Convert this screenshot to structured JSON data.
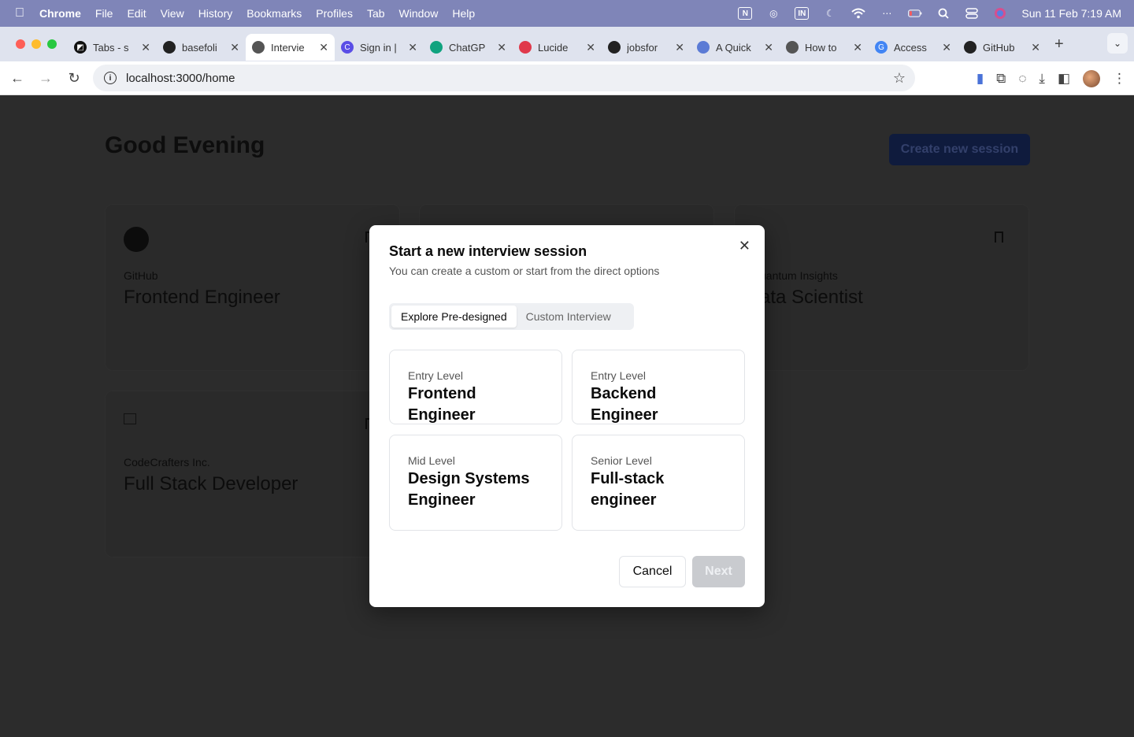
{
  "menubar": {
    "app": "Chrome",
    "items": [
      "File",
      "Edit",
      "View",
      "History",
      "Bookmarks",
      "Profiles",
      "Tab",
      "Window",
      "Help"
    ],
    "status_in": "IN",
    "datetime": "Sun 11 Feb  7:19 AM"
  },
  "tabs": [
    {
      "title": "Tabs - s",
      "icon": "notion-icon",
      "color": "#111111",
      "glyph": "◩"
    },
    {
      "title": "basefoli",
      "icon": "github-icon",
      "color": "#222222",
      "glyph": ""
    },
    {
      "title": "Intervie",
      "icon": "globe-icon",
      "color": "#555555",
      "glyph": "",
      "active": true
    },
    {
      "title": "Sign in |",
      "icon": "clerk-icon",
      "color": "#5a4ee6",
      "glyph": "C"
    },
    {
      "title": "ChatGP",
      "icon": "openai-icon",
      "color": "#10a37f",
      "glyph": ""
    },
    {
      "title": "Lucide",
      "icon": "lucide-icon",
      "color": "#e0394b",
      "glyph": ""
    },
    {
      "title": "jobsfor",
      "icon": "github-icon",
      "color": "#222222",
      "glyph": ""
    },
    {
      "title": "A Quick",
      "icon": "radar-icon",
      "color": "#5b7bd5",
      "glyph": ""
    },
    {
      "title": "How to",
      "icon": "wp-icon",
      "color": "#555555",
      "glyph": ""
    },
    {
      "title": "Access",
      "icon": "google-icon",
      "color": "#4285f4",
      "glyph": "G"
    },
    {
      "title": "GitHub",
      "icon": "github-icon",
      "color": "#222222",
      "glyph": ""
    }
  ],
  "toolbar": {
    "url": "localhost:3000/home"
  },
  "page": {
    "greeting": "Good Evening",
    "create_label": "Create new session",
    "cards": [
      {
        "company": "GitHub",
        "role": "Frontend Engineer"
      },
      {
        "company": "uantum Insights",
        "role": "ata Scientist"
      },
      {
        "company": "CodeCrafters Inc.",
        "role": "Full Stack Developer"
      }
    ]
  },
  "modal": {
    "title": "Start a new interview session",
    "subtitle": "You can create a custom or start from the direct options",
    "tab_predesigned": "Explore Pre-designed",
    "tab_custom": "Custom Interview",
    "options": [
      {
        "level": "Entry Level",
        "name": "Frontend Engineer"
      },
      {
        "level": "Entry Level",
        "name": "Backend Engineer"
      },
      {
        "level": "Mid Level",
        "name": "Design Systems Engineer"
      },
      {
        "level": "Senior Level",
        "name": "Full-stack engineer"
      }
    ],
    "cancel_label": "Cancel",
    "next_label": "Next"
  }
}
